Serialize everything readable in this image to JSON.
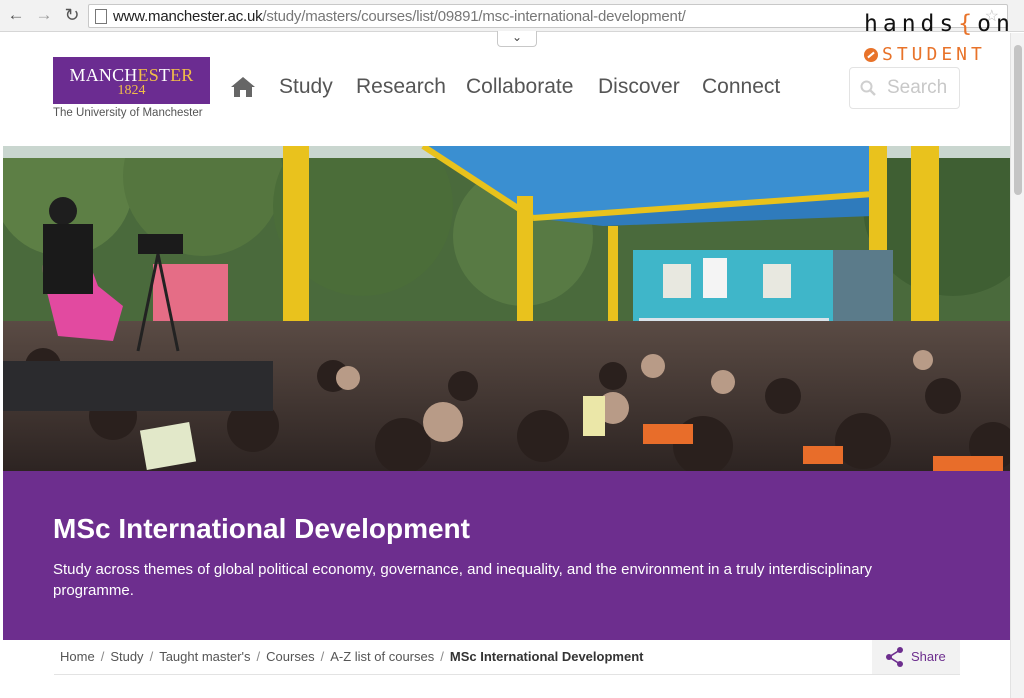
{
  "browser": {
    "url_domain": "www.manchester.ac.uk",
    "url_path": "/study/masters/courses/list/09891/msc-international-development/"
  },
  "overlay_logo": {
    "main_left": "hands",
    "brace_open": "{",
    "main_right": "on",
    "sub": "STUDENT",
    "accent_color": "#e8732a"
  },
  "header": {
    "logo_main_a": "MANCH",
    "logo_main_b": "ES",
    "logo_main_c": "T",
    "logo_main_d": "ER",
    "logo_year": "1824",
    "logo_sub": "The University of Manchester",
    "nav": {
      "study": "Study",
      "research": "Research",
      "collaborate": "Collaborate",
      "discover": "Discover",
      "connect": "Connect"
    },
    "search_placeholder": "Search"
  },
  "banner": {
    "title": "MSc International Development",
    "description": "Study across themes of global political economy, governance, and inequality, and the environment in a truly interdisciplinary programme.",
    "color": "#6d2e8e"
  },
  "breadcrumb": {
    "items": [
      "Home",
      "Study",
      "Taught master's",
      "Courses",
      "A-Z list of courses"
    ],
    "current": "MSc International Development"
  },
  "share": {
    "label": "Share"
  }
}
